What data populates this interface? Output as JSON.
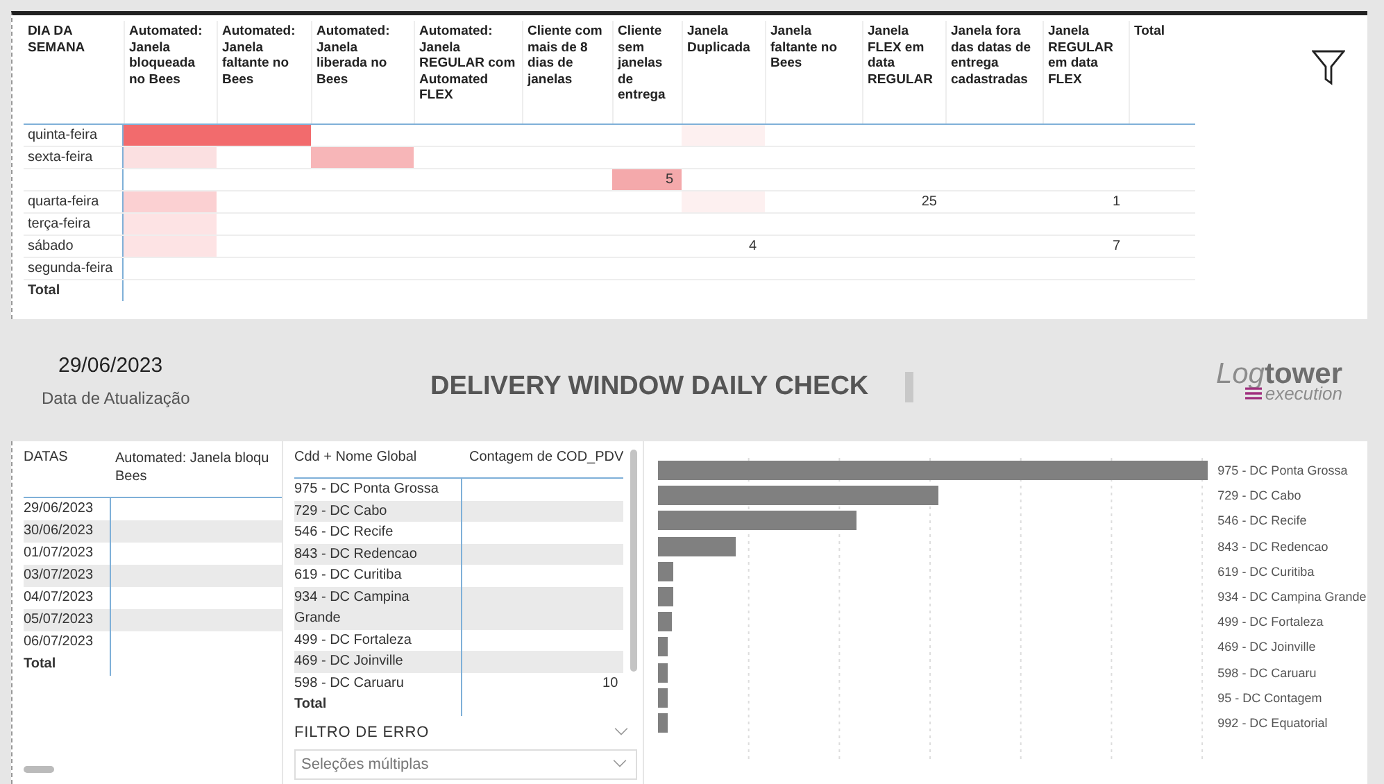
{
  "matrix": {
    "columns": [
      "DIA DA SEMANA",
      "Automated: Janela bloqueada no Bees",
      "Automated: Janela faltante no Bees",
      "Automated: Janela liberada no Bees",
      "Automated: Janela REGULAR com Automated FLEX",
      "Cliente com mais de 8 dias de janelas",
      "Cliente sem janelas de entrega",
      "Janela Duplicada",
      "Janela faltante no Bees",
      "Janela FLEX em data REGULAR",
      "Janela fora das datas de entrega cadastradas",
      "Janela REGULAR em data FLEX",
      "Total"
    ],
    "rows": [
      {
        "cells": [
          {
            "text": "quinta-feira"
          },
          {
            "color": "#f26b6d"
          },
          {
            "color": "#f26b6d"
          },
          {},
          {},
          {},
          {},
          {
            "color": "#fdf0f0"
          },
          {},
          {},
          {},
          {},
          {}
        ]
      },
      {
        "cells": [
          {
            "text": "sexta-feira"
          },
          {
            "color": "#fbe0e1"
          },
          {},
          {
            "color": "#f7b6b8"
          },
          {},
          {},
          {},
          {},
          {},
          {},
          {},
          {},
          {}
        ]
      },
      {
        "cells": [
          {},
          {},
          {},
          {},
          {},
          {},
          {
            "color": "#f4a9ab",
            "text": "5"
          },
          {},
          {},
          {},
          {},
          {},
          {}
        ]
      },
      {
        "cells": [
          {
            "text": "quarta-feira"
          },
          {
            "color": "#fbd0d2"
          },
          {},
          {},
          {},
          {},
          {},
          {
            "color": "#fdf0f0"
          },
          {},
          {
            "text": "25"
          },
          {},
          {
            "text": "1"
          },
          {}
        ]
      },
      {
        "cells": [
          {
            "text": "terça-feira"
          },
          {
            "color": "#fde3e4"
          },
          {},
          {},
          {},
          {},
          {},
          {},
          {},
          {},
          {},
          {},
          {}
        ]
      },
      {
        "cells": [
          {
            "text": "sábado"
          },
          {
            "color": "#fde3e4"
          },
          {},
          {},
          {},
          {},
          {},
          {
            "text": "4"
          },
          {},
          {},
          {},
          {
            "text": "7"
          },
          {}
        ]
      },
      {
        "cells": [
          {
            "text": "segunda-feira"
          },
          {},
          {},
          {},
          {},
          {},
          {},
          {},
          {},
          {},
          {},
          {},
          {}
        ]
      },
      {
        "cells": [
          {
            "text": "Total",
            "kind": "total"
          },
          {},
          {},
          {},
          {},
          {},
          {},
          {},
          {},
          {},
          {},
          {},
          {}
        ]
      }
    ]
  },
  "header": {
    "date": "29/06/2023",
    "date_caption": "Data de Atualização",
    "title": "DELIVERY WINDOW DAILY CHECK",
    "logo": {
      "part1": "Log",
      "part2": "tower",
      "part3": "execution"
    }
  },
  "dates_table": {
    "columns": [
      "DATAS",
      "Automated: Janela bloqu\nBees"
    ],
    "rows": [
      "29/06/2023",
      "30/06/2023",
      "01/07/2023",
      "03/07/2023",
      "04/07/2023",
      "05/07/2023",
      "06/07/2023"
    ],
    "total_label": "Total"
  },
  "cdd_table": {
    "columns": [
      "Cdd + Nome Global",
      "Contagem de COD_PDV"
    ],
    "rows": [
      {
        "name": "975 - DC Ponta Grossa"
      },
      {
        "name": "729 - DC Cabo"
      },
      {
        "name": "546 - DC Recife"
      },
      {
        "name": "843 - DC Redencao"
      },
      {
        "name": "619 - DC Curitiba"
      },
      {
        "name": "934 - DC Campina Grande"
      },
      {
        "name": "499 - DC Fortaleza"
      },
      {
        "name": "469 - DC Joinville"
      },
      {
        "name": "598 - DC Caruaru",
        "count": "10"
      }
    ],
    "total_label": "Total"
  },
  "error_filter": {
    "title": "FILTRO DE ERRO",
    "value": "Seleções múltiplas"
  },
  "bar_chart": {
    "labels": [
      "975 - DC Ponta Grossa",
      "729 - DC Cabo",
      "546 - DC Recife",
      "843 - DC Redencao",
      "619 - DC Curitiba",
      "934 - DC Campina Grande",
      "499 - DC Fortaleza",
      "469 - DC Joinville",
      "598 - DC Caruaru",
      "95 - DC Contagem",
      "992 - DC Equatorial"
    ]
  }
}
